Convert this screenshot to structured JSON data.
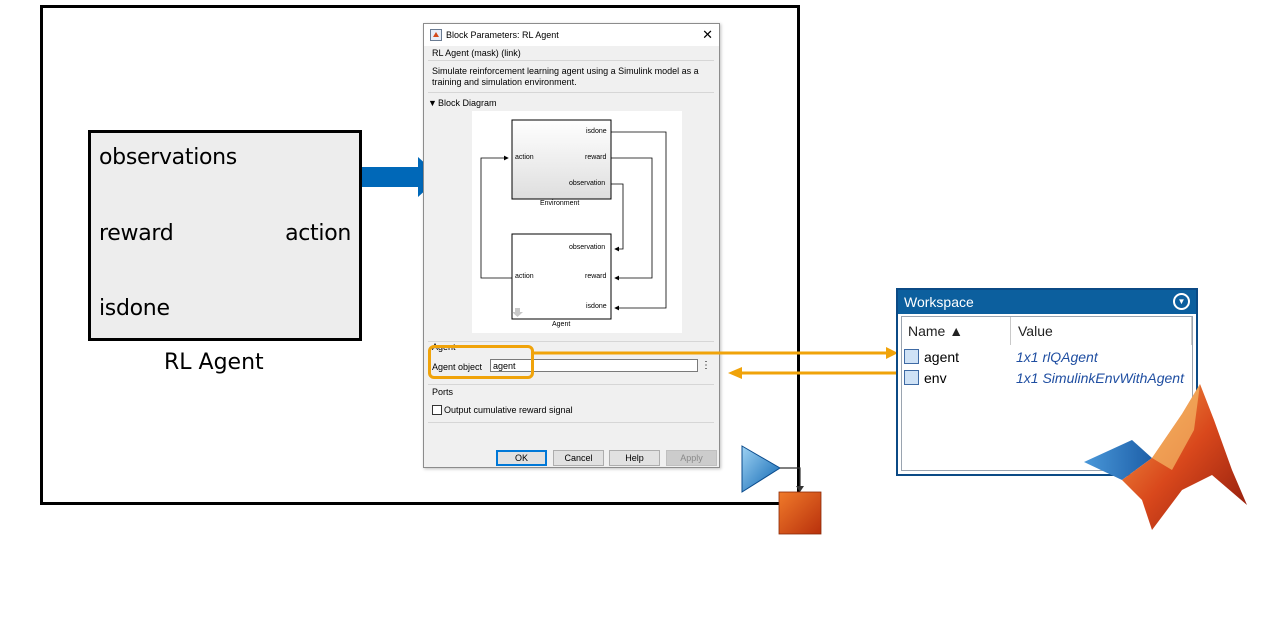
{
  "rl_block": {
    "ports": {
      "observations": "observations",
      "reward": "reward",
      "isdone": "isdone",
      "action": "action"
    },
    "caption": "RL Agent"
  },
  "dialog": {
    "title": "Block Parameters: RL Agent",
    "subtitle": "RL Agent (mask) (link)",
    "description_line1": "Simulate reinforcement learning agent using a Simulink model as a",
    "description_line2": "training and simulation environment.",
    "section_block_diagram": "Block Diagram",
    "diagram": {
      "env_ports_out": [
        "isdone",
        "reward",
        "observation"
      ],
      "env_port_in": "action",
      "env_label": "Environment",
      "agent_ports_in": [
        "observation",
        "reward",
        "isdone"
      ],
      "agent_port_out": "action",
      "agent_label": "Agent"
    },
    "section_agent": "Agent",
    "agent_object_label": "Agent object",
    "agent_object_value": "agent",
    "section_ports": "Ports",
    "checkbox_label": "Output cumulative reward signal",
    "buttons": {
      "ok": "OK",
      "cancel": "Cancel",
      "help": "Help",
      "apply": "Apply"
    }
  },
  "workspace": {
    "title": "Workspace",
    "col_name": "Name ▲",
    "col_value": "Value",
    "rows": [
      {
        "name": "agent",
        "value": "1x1 rlQAgent"
      },
      {
        "name": "env",
        "value": "1x1 SimulinkEnvWithAgent"
      }
    ]
  },
  "colors": {
    "arrow_blue": "#0068b8",
    "highlight_orange": "#f0a30a",
    "workspace_header": "#0c5f9e"
  }
}
